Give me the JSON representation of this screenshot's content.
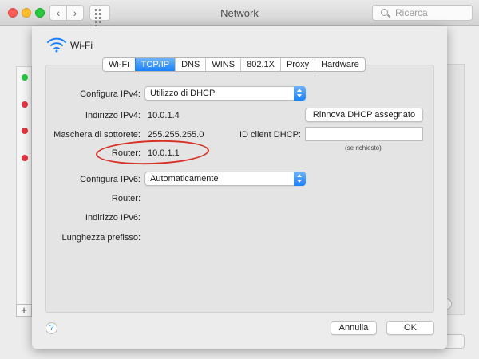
{
  "window": {
    "title": "Network"
  },
  "search": {
    "placeholder": "Ricerca"
  },
  "sheet": {
    "title": "Wi-Fi"
  },
  "tabs": [
    {
      "label": "Wi-Fi",
      "active": false
    },
    {
      "label": "TCP/IP",
      "active": true
    },
    {
      "label": "DNS",
      "active": false
    },
    {
      "label": "WINS",
      "active": false
    },
    {
      "label": "802.1X",
      "active": false
    },
    {
      "label": "Proxy",
      "active": false
    },
    {
      "label": "Hardware",
      "active": false
    }
  ],
  "form": {
    "ipv4_config_label": "Configura IPv4:",
    "ipv4_config_value": "Utilizzo di DHCP",
    "ipv4_address_label": "Indirizzo IPv4:",
    "ipv4_address_value": "10.0.1.4",
    "renew_dhcp_label": "Rinnova DHCP assegnato",
    "subnet_label": "Maschera di sottorete:",
    "subnet_value": "255.255.255.0",
    "dhcp_client_id_label": "ID client DHCP:",
    "dhcp_client_id_value": "",
    "dhcp_client_id_hint": "(se richiesto)",
    "router_label": "Router:",
    "router_value": "10.0.1.1",
    "ipv6_config_label": "Configura IPv6:",
    "ipv6_config_value": "Automaticamente",
    "ipv6_router_label": "Router:",
    "ipv6_address_label": "Indirizzo IPv6:",
    "prefix_length_label": "Lunghezza prefisso:"
  },
  "footer": {
    "help_label": "?",
    "cancel_label": "Annulla",
    "ok_label": "OK"
  },
  "sidebar_status_colors": [
    "#28c840",
    "#e7343f",
    "#e7343f",
    "#e7343f"
  ],
  "sidebar": {
    "add_label": "+"
  },
  "accent_color": "#1a82fb",
  "annotation_color": "#d63024"
}
